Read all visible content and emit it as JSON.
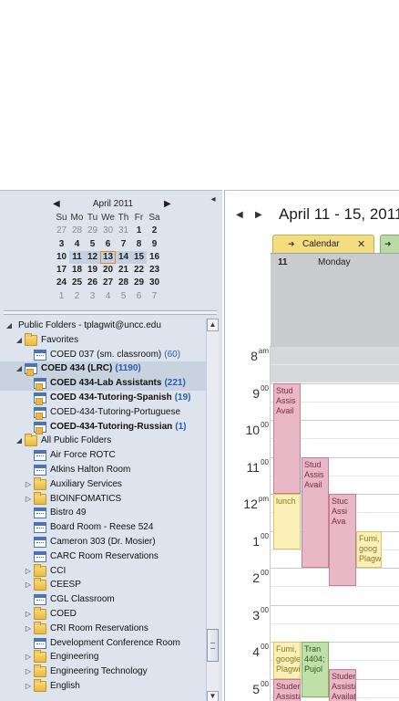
{
  "mini_calendar": {
    "month_label": "April 2011",
    "day_headers": [
      "Su",
      "Mo",
      "Tu",
      "We",
      "Th",
      "Fr",
      "Sa"
    ],
    "weeks": [
      [
        "27",
        "28",
        "29",
        "30",
        "31",
        "1",
        "2"
      ],
      [
        "3",
        "4",
        "5",
        "6",
        "7",
        "8",
        "9"
      ],
      [
        "10",
        "11",
        "12",
        "13",
        "14",
        "15",
        "16"
      ],
      [
        "17",
        "18",
        "19",
        "20",
        "21",
        "22",
        "23"
      ],
      [
        "24",
        "25",
        "26",
        "27",
        "28",
        "29",
        "30"
      ],
      [
        "1",
        "2",
        "3",
        "4",
        "5",
        "6",
        "7"
      ]
    ],
    "today": "13"
  },
  "folder_tree": [
    {
      "label": "Public Folders - tplagwit@uncc.edu",
      "count": "",
      "level": 0,
      "expander": "◢",
      "icon": "none",
      "bold": false,
      "selected": false
    },
    {
      "label": "Favorites",
      "count": "",
      "level": 1,
      "expander": "◢",
      "icon": "folder",
      "bold": false,
      "selected": false
    },
    {
      "label": "COED 037 (sm. classroom)",
      "count": "(60)",
      "level": 2,
      "expander": "",
      "icon": "calfolder",
      "bold": false,
      "selected": false
    },
    {
      "label": "COED 434 (LRC)",
      "count": "(1190)",
      "level": 1,
      "expander": "◢",
      "icon": "calgroup",
      "bold": true,
      "selected": true
    },
    {
      "label": "COED 434-Lab Assistants",
      "count": "(221)",
      "level": 2,
      "expander": "",
      "icon": "calgroup",
      "bold": true,
      "selected": true
    },
    {
      "label": "COED 434-Tutoring-Spanish",
      "count": "(19)",
      "level": 2,
      "expander": "",
      "icon": "calgroup",
      "bold": true,
      "selected": false
    },
    {
      "label": "COED-434-Tutoring-Portuguese",
      "count": "",
      "level": 2,
      "expander": "",
      "icon": "calgroup",
      "bold": false,
      "selected": false
    },
    {
      "label": "COED-434-Tutoring-Russian",
      "count": "(1)",
      "level": 2,
      "expander": "",
      "icon": "calgroup",
      "bold": true,
      "selected": false
    },
    {
      "label": "All Public Folders",
      "count": "",
      "level": 1,
      "expander": "◢",
      "icon": "folder",
      "bold": false,
      "selected": false
    },
    {
      "label": "Air Force ROTC",
      "count": "",
      "level": 2,
      "expander": "",
      "icon": "calfolder",
      "bold": false,
      "selected": false
    },
    {
      "label": "Atkins Halton Room",
      "count": "",
      "level": 2,
      "expander": "",
      "icon": "calfolder",
      "bold": false,
      "selected": false
    },
    {
      "label": "Auxiliary Services",
      "count": "",
      "level": 2,
      "expander": "▷",
      "icon": "folder",
      "bold": false,
      "selected": false
    },
    {
      "label": "BIOINFOMATICS",
      "count": "",
      "level": 2,
      "expander": "▷",
      "icon": "folder",
      "bold": false,
      "selected": false
    },
    {
      "label": "Bistro 49",
      "count": "",
      "level": 2,
      "expander": "",
      "icon": "calfolder",
      "bold": false,
      "selected": false
    },
    {
      "label": "Board Room - Reese 524",
      "count": "",
      "level": 2,
      "expander": "",
      "icon": "calfolder",
      "bold": false,
      "selected": false
    },
    {
      "label": "Cameron 303 (Dr. Mosier)",
      "count": "",
      "level": 2,
      "expander": "",
      "icon": "calfolder",
      "bold": false,
      "selected": false
    },
    {
      "label": "CARC Room Reservations",
      "count": "",
      "level": 2,
      "expander": "",
      "icon": "calfolder",
      "bold": false,
      "selected": false
    },
    {
      "label": "CCI",
      "count": "",
      "level": 2,
      "expander": "▷",
      "icon": "folder",
      "bold": false,
      "selected": false
    },
    {
      "label": "CEESP",
      "count": "",
      "level": 2,
      "expander": "▷",
      "icon": "folder",
      "bold": false,
      "selected": false
    },
    {
      "label": "CGL Classroom",
      "count": "",
      "level": 2,
      "expander": "",
      "icon": "calfolder",
      "bold": false,
      "selected": false
    },
    {
      "label": "COED",
      "count": "",
      "level": 2,
      "expander": "▷",
      "icon": "folder",
      "bold": false,
      "selected": false
    },
    {
      "label": "CRI Room Reservations",
      "count": "",
      "level": 2,
      "expander": "▷",
      "icon": "folder",
      "bold": false,
      "selected": false
    },
    {
      "label": "Development Conference Room",
      "count": "",
      "level": 2,
      "expander": "",
      "icon": "calfolder",
      "bold": false,
      "selected": false
    },
    {
      "label": "Engineering",
      "count": "",
      "level": 2,
      "expander": "▷",
      "icon": "folder",
      "bold": false,
      "selected": false
    },
    {
      "label": "Engineering Technology",
      "count": "",
      "level": 2,
      "expander": "▷",
      "icon": "folder",
      "bold": false,
      "selected": false
    },
    {
      "label": "English",
      "count": "",
      "level": 2,
      "expander": "▷",
      "icon": "folder",
      "bold": false,
      "selected": false
    }
  ],
  "calendar_view": {
    "date_range": "April 11 - 15, 2011",
    "tab_label": "Calendar",
    "day_number": "11",
    "day_name": "Monday",
    "time_slots": [
      {
        "hour": "8",
        "suffix": "am"
      },
      {
        "hour": "9",
        "suffix": "00"
      },
      {
        "hour": "10",
        "suffix": "00"
      },
      {
        "hour": "11",
        "suffix": "00"
      },
      {
        "hour": "12",
        "suffix": "pm"
      },
      {
        "hour": "1",
        "suffix": "00"
      },
      {
        "hour": "2",
        "suffix": "00"
      },
      {
        "hour": "3",
        "suffix": "00"
      },
      {
        "hour": "4",
        "suffix": "00"
      },
      {
        "hour": "5",
        "suffix": "00"
      }
    ],
    "appointments": [
      {
        "text": "Stud Assis Avail",
        "color": "pink",
        "start": 9.0,
        "end": 12.0,
        "lane": 0
      },
      {
        "text": "Stud Assis Avail",
        "color": "pink",
        "start": 11.0,
        "end": 14.0,
        "lane": 1
      },
      {
        "text": "lunch",
        "color": "yellow",
        "start": 12.0,
        "end": 13.5,
        "lane": 0
      },
      {
        "text": "Stuc Assi Ava",
        "color": "pink",
        "start": 12.0,
        "end": 14.5,
        "lane": 2
      },
      {
        "text": "Fumi, goog Plagw",
        "color": "yellow",
        "start": 13.0,
        "end": 14.0,
        "lane": 3
      },
      {
        "text": "Fumi, google Plagwi",
        "color": "yellow",
        "start": 16.0,
        "end": 17.0,
        "lane": 0
      },
      {
        "text": "Tran 4404; Pujol",
        "color": "green",
        "start": 16.0,
        "end": 17.5,
        "lane": 1
      },
      {
        "text": "Studen Assista Availat",
        "color": "pink",
        "start": 16.75,
        "end": 18.5,
        "lane": 2
      },
      {
        "text": "Studen Assista Availat",
        "color": "pink",
        "start": 17.0,
        "end": 18.5,
        "lane": 0
      }
    ]
  }
}
